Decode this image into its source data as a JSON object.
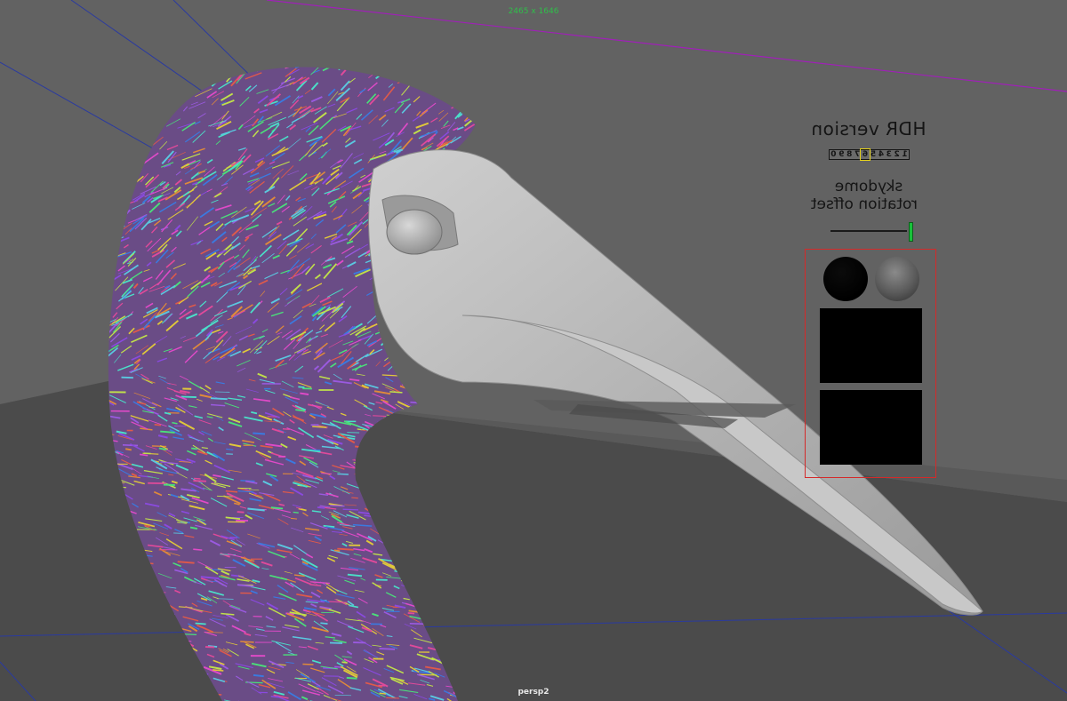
{
  "viewport": {
    "resolution_gate_label": "2465 x 1646",
    "camera_name": "persp2"
  },
  "hdr_panel": {
    "title": "HDR version",
    "digits": [
      "1",
      "2",
      "3",
      "4",
      "5",
      "6",
      "7",
      "8",
      "9",
      "0"
    ],
    "selected_digit": "6",
    "rotation_label_line1": "skydome",
    "rotation_label_line2": "rotation offset",
    "rotation_value": 1.0
  },
  "scene_icons": {
    "bird_head": "crane-head-model-icon",
    "feathers": "xgen-feather-curves-icon"
  },
  "colors": {
    "viewport_bg": "#5e5e5e",
    "wall": "#6b6b6b",
    "floor": "#4a4a4a",
    "beak": "#b8b8b8",
    "gate_line": "#a020b8",
    "grid_line": "#2a3aa0",
    "panel_border": "#d42a2a",
    "slider_handle": "#19c23a",
    "selection": "#e6d21a"
  }
}
